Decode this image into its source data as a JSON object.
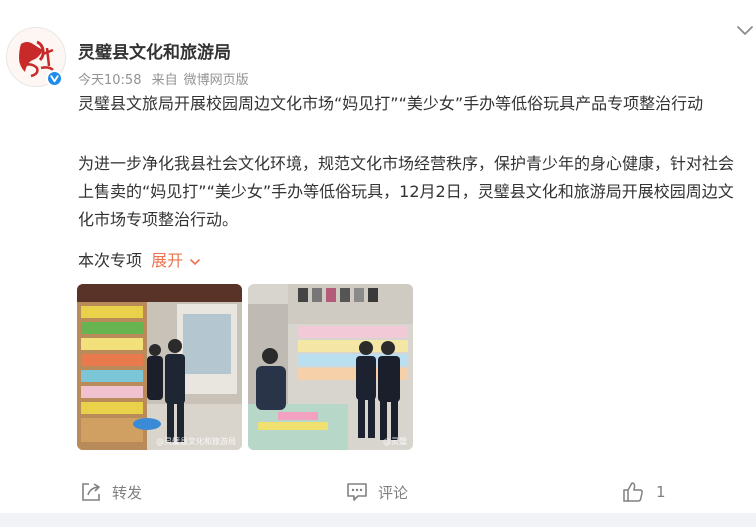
{
  "author": {
    "name": "灵璧县文化和旅游局",
    "avatar_icon": "org-logo-icon",
    "verified_icon": "verified-v-icon"
  },
  "meta": {
    "time": "今天10:58",
    "source_prefix": "来自",
    "source": "微博网页版"
  },
  "post": {
    "title": "灵璧县文旅局开展校园周边文化市场“妈见打”“美少女”手办等低俗玩具产品专项整治行动",
    "body": "为进一步净化我县社会文化环境，规范文化市场经营秩序，保护青少年的身心健康，针对社会上售卖的“妈见打”“美少女”手办等低俗玩具，12月2日，灵璧县文化和旅游局开展校园周边文化市场专项整治行动。",
    "topic_label": "本次专项",
    "expand_label": "展开"
  },
  "photos": [
    {
      "name": "photo-store-inspection-1",
      "watermark": "@灵璧县文化和旅游局"
    },
    {
      "name": "photo-store-inspection-2",
      "watermark": "@灵璧"
    }
  ],
  "actions": {
    "share_label": "转发",
    "comment_label": "评论",
    "like_count": "1"
  },
  "colors": {
    "accent": "#eb7350",
    "verified": "#1f8ceb",
    "text": "#333333",
    "meta": "#939393"
  }
}
